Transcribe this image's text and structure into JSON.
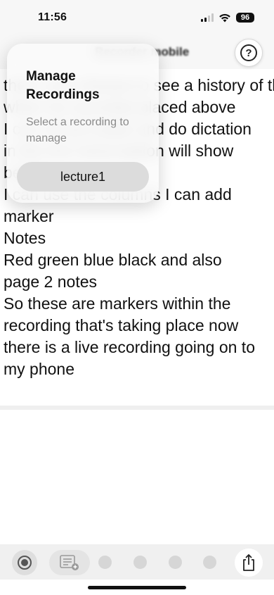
{
  "status_bar": {
    "time": "11:56",
    "battery": "96"
  },
  "nav": {
    "title": "Recorder mobile"
  },
  "note": {
    "lines": [
      "then I can choose to see a history of the",
      "what I've recorded placed above",
      "I can record audio and do dictation",
      "in the live transcription will show",
      "below",
      "I can use the columns I can add",
      "marker",
      "Notes",
      "Red green blue black and also",
      "page 2 notes",
      "So these are markers within the",
      "recording that's taking place now",
      "there is a live recording going on to",
      "my phone"
    ]
  },
  "popover": {
    "title": "Manage Recordings",
    "subtitle": "Select a recording to manage",
    "recordings": [
      "lecture1"
    ]
  },
  "toolbar": {
    "icons": [
      "record-icon",
      "notes-add-icon",
      "marker-dot",
      "marker-dot",
      "marker-dot",
      "marker-dot",
      "share-icon"
    ],
    "marker_colors": [
      "#d6d6d6",
      "#d6d6d6",
      "#d6d6d6",
      "#d6d6d6"
    ]
  }
}
